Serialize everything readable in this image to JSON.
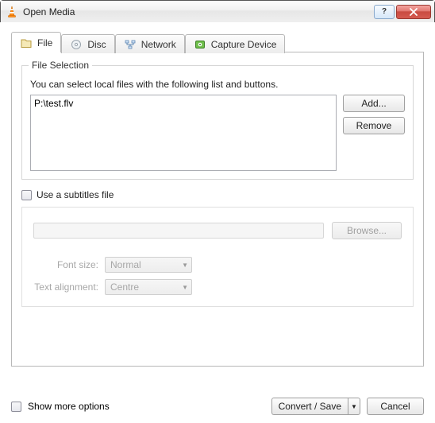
{
  "window": {
    "title": "Open Media"
  },
  "tabs": {
    "file": "File",
    "disc": "Disc",
    "network": "Network",
    "capture": "Capture Device"
  },
  "file_selection": {
    "legend": "File Selection",
    "hint": "You can select local files with the following list and buttons.",
    "items": [
      "P:\\test.flv"
    ],
    "add_label": "Add...",
    "remove_label": "Remove"
  },
  "subtitles": {
    "checkbox_label": "Use a subtitles file",
    "browse_label": "Browse...",
    "font_size_label": "Font size:",
    "font_size_value": "Normal",
    "alignment_label": "Text alignment:",
    "alignment_value": "Centre"
  },
  "footer": {
    "show_more_label": "Show more options",
    "convert_label": "Convert / Save",
    "cancel_label": "Cancel"
  }
}
